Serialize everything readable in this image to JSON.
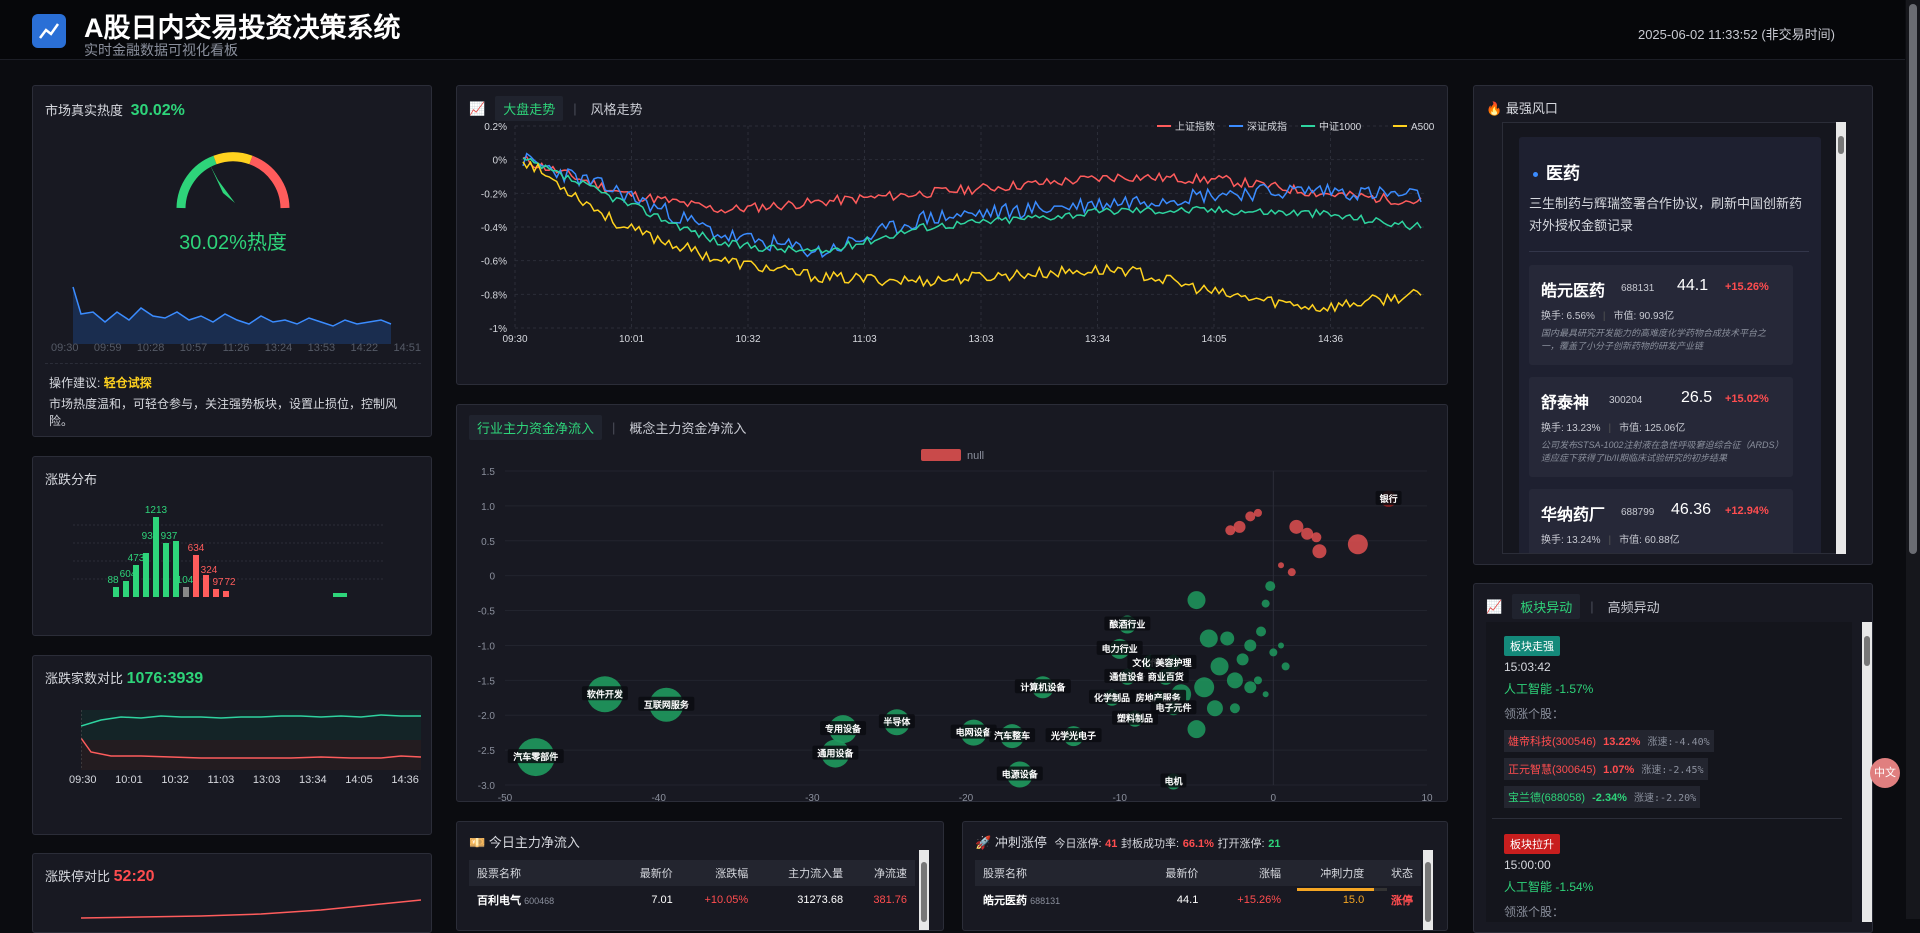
{
  "header": {
    "title": "A股日内交易投资决策系统",
    "subtitle": "实时金融数据可视化看板",
    "datetime": "2025-06-02 11:33:52 (非交易时间)"
  },
  "heat": {
    "label": "市场真实热度",
    "value": "30.02%",
    "gauge_text": "30.02%热度",
    "gauge_value": 30.02,
    "x_ticks": [
      "09:30",
      "09:59",
      "10:28",
      "10:57",
      "11:26",
      "13:24",
      "13:53",
      "14:22",
      "14:51"
    ],
    "advice_label": "操作建议:",
    "advice_value": "轻仓试探",
    "advice_text": "市场热度温和，可轻仓参与，关注强势板块，设置止损位，控制风险。"
  },
  "distribution": {
    "title": "涨跌分布",
    "labels": [
      "1213",
      "930",
      "937",
      "473",
      "604",
      "88",
      "634",
      "104",
      "324",
      "97",
      "72"
    ]
  },
  "updown_count": {
    "label": "涨跌家数对比",
    "value": "1076:3939",
    "x_ticks": [
      "09:30",
      "10:01",
      "10:32",
      "11:03",
      "13:03",
      "13:34",
      "14:05",
      "14:36"
    ]
  },
  "limit_count": {
    "label": "涨跌停对比",
    "value": "52:20"
  },
  "index_chart": {
    "tabs": [
      "大盘走势",
      "风格走势"
    ],
    "legend": [
      "上证指数",
      "深证成指",
      "中证1000",
      "A500"
    ],
    "colors": {
      "上证指数": "#ff5c5c",
      "深证成指": "#3b8cff",
      "中证1000": "#2ed4a0",
      "A500": "#ffd21f"
    },
    "y_ticks": [
      "0.2%",
      "0%",
      "-0.2%",
      "-0.4%",
      "-0.6%",
      "-0.8%",
      "-1%"
    ],
    "x_ticks": [
      "09:30",
      "10:01",
      "10:32",
      "11:03",
      "13:03",
      "13:34",
      "14:05",
      "14:36"
    ]
  },
  "bubble_chart": {
    "tabs": [
      "行业主力资金净流入",
      "概念主力资金净流入"
    ],
    "legend": "null",
    "y_ticks": [
      "1.5",
      "1.0",
      "0.5",
      "0",
      "-0.5",
      "-1.0",
      "-1.5",
      "-2.0",
      "-2.5",
      "-3.0"
    ],
    "x_ticks": [
      "-50",
      "-40",
      "-30",
      "-20",
      "-10",
      "0",
      "10"
    ],
    "labels": [
      "银行",
      "酿酒行业",
      "电力行业",
      "文化传媒",
      "美容护理",
      "通信设备",
      "商业百货",
      "计算机设备",
      "化学制品",
      "房地产服务",
      "电子元件",
      "塑料制品",
      "软件开发",
      "互联网服务",
      "半导体",
      "专用设备",
      "通用设备",
      "电网设备",
      "汽车整车",
      "光学光电子",
      "汽车零部件",
      "电源设备",
      "电机"
    ]
  },
  "strongest": {
    "title": "最强风口",
    "sector": "医药",
    "news": "三生制药与辉瑞签署合作协议，刷新中国创新药对外授权金额记录",
    "stocks": [
      {
        "name": "皓元医药",
        "code": "688131",
        "price": "44.1",
        "pct": "+15.26%",
        "turnover": "换手: 6.56%",
        "cap": "市值: 90.93亿",
        "desc": "国内最具研究开发能力的高难度化学药物合成技术平台之一，覆盖了小分子创新药物的研发产业链"
      },
      {
        "name": "舒泰神",
        "code": "300204",
        "price": "26.5",
        "pct": "+15.02%",
        "turnover": "换手: 13.23%",
        "cap": "市值: 125.06亿",
        "desc": "公司发布STSA-1002注射液在急性呼吸窘迫综合征（ARDS）适应症下获得了Ib/II期临床试验研究的初步结果"
      },
      {
        "name": "华纳药厂",
        "code": "688799",
        "price": "46.36",
        "pct": "+12.94%",
        "turnover": "换手: 13.24%",
        "cap": "市值: 60.88亿",
        "desc": ""
      }
    ]
  },
  "sector_moves": {
    "tabs": [
      "板块异动",
      "高频异动"
    ],
    "items": [
      {
        "tag": "板块走强",
        "time": "15:03:42",
        "sector": "人工智能 -1.57%",
        "lead_label": "领涨个股：",
        "stocks": [
          {
            "name": "雄帝科技(300546)",
            "pct": "13.22%",
            "speed": "涨速:-4.40%"
          },
          {
            "name": "正元智慧(300645)",
            "pct": "1.07%",
            "speed": "涨速:-2.45%"
          },
          {
            "name": "宝兰德(688058)",
            "pct": "-2.34%",
            "speed": "涨速:-2.20%"
          }
        ]
      },
      {
        "tag": "板块拉升",
        "time": "15:00:00",
        "sector": "人工智能 -1.54%",
        "lead_label": "领涨个股："
      }
    ]
  },
  "main_inflow": {
    "title": "今日主力净流入",
    "headers": [
      "股票名称",
      "最新价",
      "涨跌幅",
      "主力流入量",
      "净流速"
    ],
    "rows": [
      {
        "name": "百利电气",
        "code": "600468",
        "price": "7.01",
        "pct": "+10.05%",
        "inflow": "31273.68",
        "speed": "381.76"
      }
    ]
  },
  "limit_up": {
    "title": "冲刺涨停",
    "summary_a": "今日涨停:",
    "count": "41",
    "summary_b": "封板成功率:",
    "rate": "66.1%",
    "summary_c": "打开涨停:",
    "opened": "21",
    "headers": [
      "股票名称",
      "最新价",
      "涨幅",
      "冲刺力度",
      "状态"
    ],
    "rows": [
      {
        "name": "皓元医药",
        "code": "688131",
        "price": "44.1",
        "pct": "+15.26%",
        "force": "15.0",
        "status": "涨停"
      }
    ]
  },
  "float_button": "中文"
}
